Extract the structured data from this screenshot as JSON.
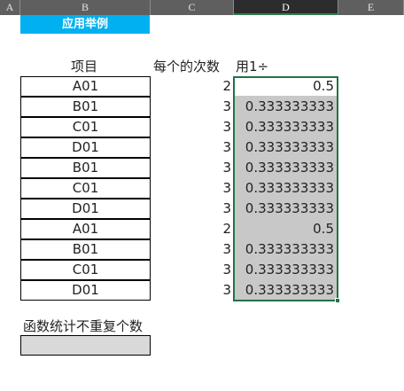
{
  "column_headers": [
    "A",
    "B",
    "C",
    "D",
    "E"
  ],
  "selected_column": "D",
  "banner_title": "应用举例",
  "labels": {
    "item_header": "项目",
    "count_header": "每个的次数",
    "formula_header": "用1÷",
    "distinct_label": "函数统计不重复个数"
  },
  "rows": [
    {
      "item": "A01",
      "count": "2",
      "ratio": "0.5"
    },
    {
      "item": "B01",
      "count": "3",
      "ratio": "0.333333333"
    },
    {
      "item": "C01",
      "count": "3",
      "ratio": "0.333333333"
    },
    {
      "item": "D01",
      "count": "3",
      "ratio": "0.333333333"
    },
    {
      "item": "B01",
      "count": "3",
      "ratio": "0.333333333"
    },
    {
      "item": "C01",
      "count": "3",
      "ratio": "0.333333333"
    },
    {
      "item": "D01",
      "count": "3",
      "ratio": "0.333333333"
    },
    {
      "item": "A01",
      "count": "2",
      "ratio": "0.5"
    },
    {
      "item": "B01",
      "count": "3",
      "ratio": "0.333333333"
    },
    {
      "item": "C01",
      "count": "3",
      "ratio": "0.333333333"
    },
    {
      "item": "D01",
      "count": "3",
      "ratio": "0.333333333"
    }
  ],
  "distinct_result": "",
  "colors": {
    "banner": "#00b0f0",
    "selection_border": "#217346",
    "selected_fill": "#c8c8c8",
    "header_bg": "#5f5f5f"
  }
}
